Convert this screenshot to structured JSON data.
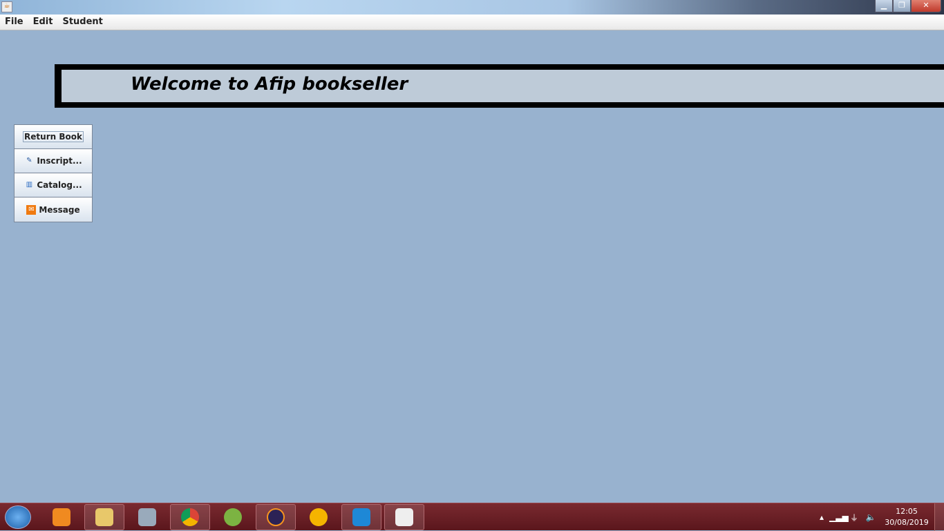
{
  "menu": {
    "items": [
      "File",
      "Edit",
      "Student"
    ]
  },
  "banner": {
    "text": "Welcome to Afip bookseller"
  },
  "sidebar": {
    "buttons": [
      {
        "label": "Return Book",
        "icon": ""
      },
      {
        "label": "Inscript...",
        "icon": "edit-icon"
      },
      {
        "label": "Catalog...",
        "icon": "book-icon"
      },
      {
        "label": "Message",
        "icon": "mail-icon"
      }
    ]
  },
  "taskbar": {
    "apps": [
      "media-player",
      "file-explorer",
      "calculator",
      "chrome",
      "android-studio",
      "eclipse",
      "browser",
      "vscode",
      "java"
    ],
    "time": "12:05",
    "date": "30/08/2019"
  },
  "colors": {
    "background": "#98b2cf",
    "banner": "#becbd8",
    "taskbar": "#6a1f25"
  }
}
